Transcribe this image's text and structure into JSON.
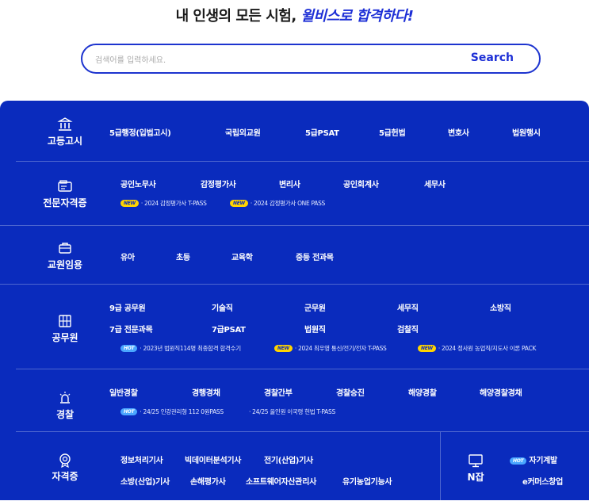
{
  "headline": {
    "prefix": "내 인생의 모든 시험, ",
    "accent": "윌비스로 합격하다!"
  },
  "search": {
    "placeholder": "검색어를 입력하세요.",
    "button": "Search"
  },
  "categories": {
    "gosi": {
      "name": "고등고시",
      "links": [
        "5급행정(입법고시)",
        "국립외교원",
        "5급PSAT",
        "5급헌법",
        "변호사",
        "법원행시"
      ]
    },
    "license": {
      "name": "전문자격증",
      "links": [
        "공인노무사",
        "감정평가사",
        "변리사",
        "공인회계사",
        "세무사"
      ],
      "promos": [
        {
          "badge": "NEW",
          "text": "· 2024 감정평가사 T-PASS"
        },
        {
          "badge": "NEW",
          "text": "· 2024 감정평가사 ONE PASS"
        }
      ]
    },
    "teacher": {
      "name": "교원임용",
      "links": [
        "유아",
        "초등",
        "교육학",
        "중등 전과목"
      ]
    },
    "civil": {
      "name": "공무원",
      "links": [
        "9급 공무원",
        "기술직",
        "군무원",
        "세무직",
        "소방직",
        "7급 전문과목",
        "7급PSAT",
        "법원직",
        "검찰직"
      ],
      "promos": [
        {
          "badge": "HOT",
          "text": "· 2023년 법원직114명 최종합격 합격수기"
        },
        {
          "badge": "NEW",
          "text": "· 2024 최우영 통신/전기/전자 T-PASS"
        },
        {
          "badge": "NEW",
          "text": "· 2024 정사원 농업직/지도사 이론 PACK"
        }
      ]
    },
    "police": {
      "name": "경찰",
      "links": [
        "일반경찰",
        "경행경채",
        "경찰간부",
        "경찰승진",
        "해양경찰",
        "해양경찰경채"
      ],
      "promos": [
        {
          "badge": "HOT",
          "text": "· 24/25 인강관리형 112 0원PASS"
        },
        {
          "badge": "",
          "text": "· 24/25 올인원 이국령 헌법 T-PASS"
        }
      ]
    },
    "cert": {
      "name": "자격증",
      "links": [
        "정보처리기사",
        "빅데이터분석기사",
        "전기(산업)기사",
        "소방(산업)기사",
        "손해평가사",
        "소프트웨어자산관리사",
        "유기농업기능사"
      ]
    },
    "njob": {
      "name": "N잡",
      "badge": "HOT",
      "links": [
        "자기계발",
        "e커머스창업"
      ]
    }
  },
  "colors": {
    "panel": "#0a2bbd",
    "accent": "#1d2fd6",
    "new_badge": "#ffd400",
    "hot_badge": "#4aa6ff"
  },
  "icons": {
    "gosi": "pillar-building-icon",
    "license": "license-card-icon",
    "teacher": "briefcase-icon",
    "civil": "cabinet-icon",
    "police": "siren-icon",
    "cert": "medal-icon",
    "njob": "monitor-icon"
  }
}
